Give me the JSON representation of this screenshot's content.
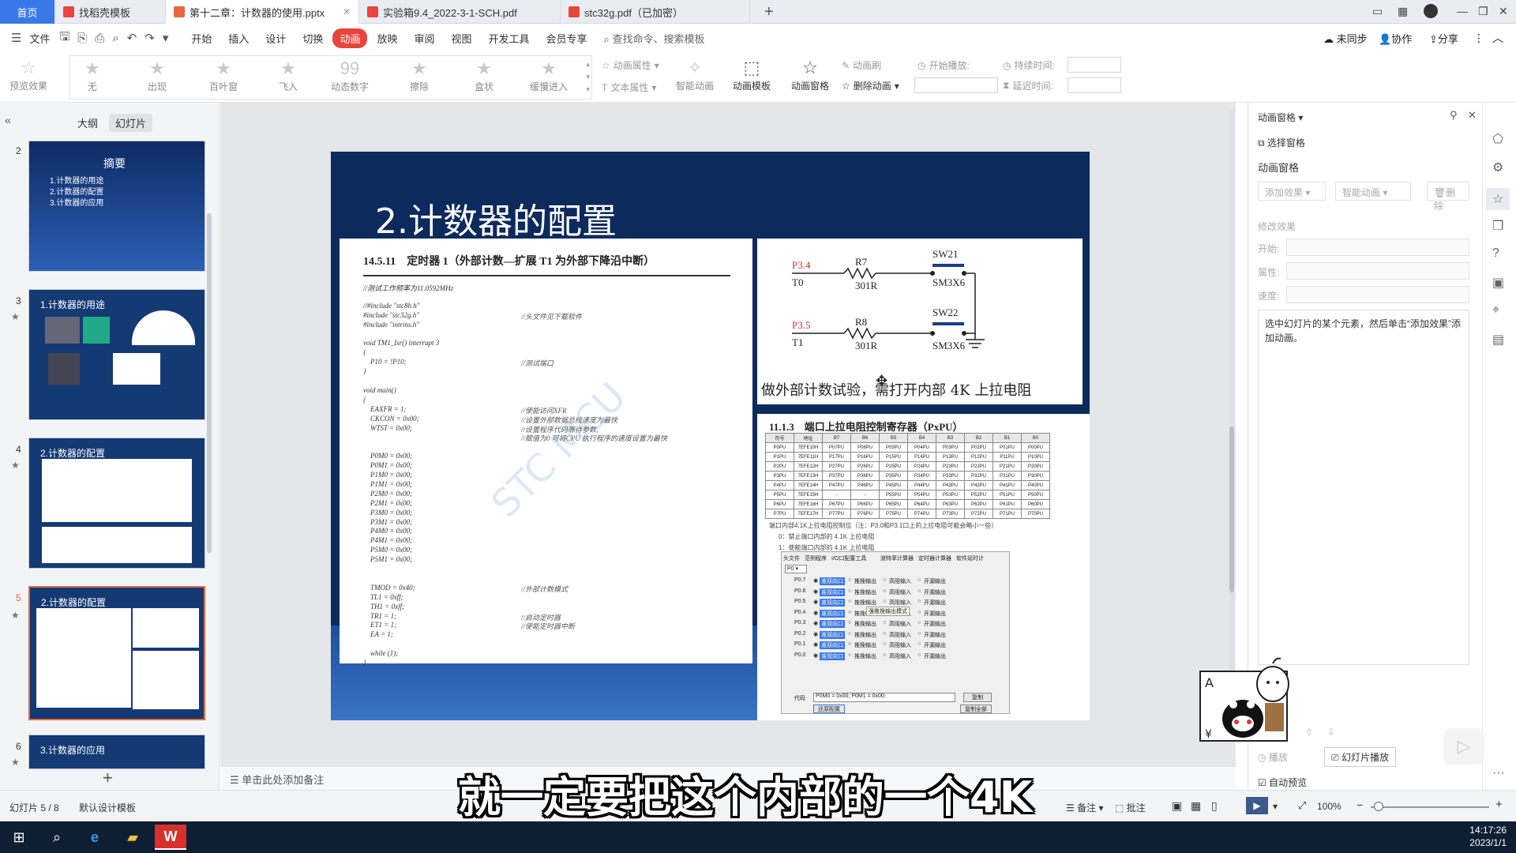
{
  "tabs": [
    {
      "label": "首页",
      "type": "home"
    },
    {
      "label": "找稻壳模板",
      "color": "#e8453c"
    },
    {
      "label": "第十二章：计数器的使用.pptx",
      "color": "#e8663c",
      "active": true
    },
    {
      "label": "实验箱9.4_2022-3-1-SCH.pdf",
      "color": "#e8453c"
    },
    {
      "label": "stc32g.pdf（已加密）",
      "color": "#e8453c"
    }
  ],
  "menu": {
    "file": "文件",
    "items": [
      "开始",
      "插入",
      "设计",
      "切换",
      "动画",
      "放映",
      "审阅",
      "视图",
      "开发工具",
      "会员专享"
    ],
    "active": "动画",
    "search": "查找命令、搜索模板",
    "sync": "未同步",
    "collab": "协作",
    "share": "分享"
  },
  "ribbon": {
    "preview": "预览效果",
    "gallery": [
      "无",
      "出现",
      "百叶窗",
      "飞入",
      "动态数字",
      "擦除",
      "盒状",
      "缓慢进入"
    ],
    "anim_props": "动画属性",
    "text_props": "文本属性",
    "smart_anim": "智能动画",
    "anim_template": "动画模板",
    "anim_pane": "动画窗格",
    "anim_brush": "动画刷",
    "delete_anim": "删除动画",
    "start_play": "开始播放:",
    "duration": "持续时间:",
    "delay": "延迟时间:"
  },
  "left_panel": {
    "tab_outline": "大纲",
    "tab_slides": "幻灯片",
    "thumbnails": [
      {
        "num": "2",
        "title": "摘要",
        "lines": [
          "1.计数器的用途",
          "2.计数器的配置",
          "3.计数器的应用"
        ]
      },
      {
        "num": "3",
        "title": "1.计数器的用途",
        "lines": []
      },
      {
        "num": "4",
        "title": "2.计数器的配置",
        "lines": []
      },
      {
        "num": "5",
        "title": "2.计数器的配置",
        "lines": [],
        "selected": true
      },
      {
        "num": "6",
        "title": "3.计数器的应用",
        "lines": []
      }
    ]
  },
  "slide": {
    "title": "2.计数器的配置",
    "code_heading": "14.5.11　定时器 1（外部计数—扩展 T1 为外部下降沿中断）",
    "code_lines": [
      "//测试工作频率为11.0592MHz",
      "",
      "//#include \"stc8h.h\"",
      "#include \"stc32g.h\"",
      "#include \"intrins.h\"",
      "",
      "void TM1_Isr() interrupt 3",
      "{",
      "    P10 = !P10;",
      "}",
      "",
      "void main()",
      "{",
      "    EAXFR = 1;",
      "    CKCON = 0x00;",
      "    WTST = 0x00;",
      "",
      "",
      "    P0M0 = 0x00;",
      "    P0M1 = 0x00;",
      "    P1M0 = 0x00;",
      "    P1M1 = 0x00;",
      "    P2M0 = 0x00;",
      "    P2M1 = 0x00;",
      "    P3M0 = 0x00;",
      "    P3M1 = 0x00;",
      "    P4M0 = 0x00;",
      "    P4M1 = 0x00;",
      "    P5M0 = 0x00;",
      "    P5M1 = 0x00;",
      "",
      "",
      "    TMOD = 0x40;",
      "    TL1 = 0xff;",
      "    TH1 = 0xff;",
      "    TR1 = 1;",
      "    ET1 = 1;",
      "    EA = 1;",
      "",
      "    while (1);",
      "}"
    ],
    "code_comments": [
      {
        "line": 3,
        "text": "//头文件见下载软件"
      },
      {
        "line": 8,
        "text": "//测试端口"
      },
      {
        "line": 13,
        "text": "//使能访问XFR"
      },
      {
        "line": 14,
        "text": "//设置外部数据总线速度为最快"
      },
      {
        "line": 15,
        "text": "//设置程序代码等待参数,"
      },
      {
        "line": 16,
        "text": "//赋值为0 可将CPU 执行程序的速度设置为最快"
      },
      {
        "line": 32,
        "text": "//外部计数模式"
      },
      {
        "line": 35,
        "text": "//启动定时器"
      },
      {
        "line": 36,
        "text": "//使能定时器中断"
      }
    ],
    "watermark": "STC MCU",
    "circuit": {
      "p34": "P3.4",
      "t0": "T0",
      "r7": "R7",
      "r7v": "301R",
      "sw21": "SW21",
      "sw21m": "SM3X6",
      "p35": "P3.5",
      "t1": "T1",
      "r8": "R8",
      "r8v": "301R",
      "sw22": "SW22",
      "sw22m": "SM3X6",
      "caption": "做外部计数试验，需打开内部 4K 上拉电阻"
    },
    "pxpu_heading": "11.1.3　端口上拉电阻控制寄存器（PxPU）",
    "pxpu_header": [
      "符号",
      "地址",
      "B7",
      "B6",
      "B5",
      "B4",
      "B3",
      "B2",
      "B1",
      "B0"
    ],
    "pxpu_rows": [
      [
        "P0PU",
        "7EFE10H",
        "P07PU",
        "P06PU",
        "P05PU",
        "P04PU",
        "P03PU",
        "P02PU",
        "P01PU",
        "P00PU"
      ],
      [
        "P1PU",
        "7EFE11H",
        "P17PU",
        "P16PU",
        "P15PU",
        "P14PU",
        "P13PU",
        "P12PU",
        "P11PU",
        "P10PU"
      ],
      [
        "P2PU",
        "7EFE12H",
        "P27PU",
        "P26PU",
        "P25PU",
        "P24PU",
        "P23PU",
        "P22PU",
        "P21PU",
        "P20PU"
      ],
      [
        "P3PU",
        "7EFE13H",
        "P37PU",
        "P36PU",
        "P35PU",
        "P34PU",
        "P33PU",
        "P32PU",
        "P31PU",
        "P30PU"
      ],
      [
        "P4PU",
        "7EFE14H",
        "P47PU",
        "P46PU",
        "P45PU",
        "P44PU",
        "P43PU",
        "P42PU",
        "P41PU",
        "P40PU"
      ],
      [
        "P5PU",
        "7EFE15H",
        "-",
        "-",
        "P55PU",
        "P54PU",
        "P53PU",
        "P52PU",
        "P51PU",
        "P50PU"
      ],
      [
        "P6PU",
        "7EFE16H",
        "P67PU",
        "P66PU",
        "P65PU",
        "P64PU",
        "P63PU",
        "P62PU",
        "P61PU",
        "P60PU"
      ],
      [
        "P7PU",
        "7EFE17H",
        "P77PU",
        "P76PU",
        "P75PU",
        "P74PU",
        "P73PU",
        "P72PU",
        "P71PU",
        "P70PU"
      ]
    ],
    "pxpu_notes": [
      "端口内部4.1K上拉电阻控制位（注：P3.0和P3.1口上的上拉电阻可能会略小一些）",
      "0：禁止端口内部的 4.1K 上拉电阻",
      "1：使能端口内部的 4.1K 上拉电阻"
    ],
    "tool_tabs": [
      "头文件",
      "范例程序",
      "I/O口配置工具",
      "波特率计算器",
      "定时器计算器",
      "软件延时计"
    ],
    "tool_port": "P0",
    "tool_rows": [
      "P0.7",
      "P0.6",
      "P0.5",
      "P0.4",
      "P0.3",
      "P0.2",
      "P0.1",
      "P0.0"
    ],
    "tool_opts": [
      "准双向口",
      "推挽输出",
      "高阻输入",
      "开漏输出"
    ],
    "tool_tooltip": "强推挽输出模式",
    "tool_code_label": "代码",
    "tool_code": "P0M0 = 0x00;  P0M1 = 0x00;",
    "tool_copy": "复制",
    "tool_reset": "还原配置",
    "tool_copy_all": "复制全部"
  },
  "notes_placeholder": "单击此处添加备注",
  "right_panel": {
    "title": "动画窗格",
    "select_pane": "选择窗格",
    "section": "动画窗格",
    "add_effect": "添加效果",
    "smart_anim": "智能动画",
    "delete": "删除",
    "modify": "修改效果",
    "start": "开始:",
    "prop": "属性:",
    "speed": "速度:",
    "hint": "选中幻灯片的某个元素，然后单击“添加效果”添加动画。",
    "play": "播放",
    "slideshow": "幻灯片播放",
    "autopreview": "自动预览"
  },
  "status": {
    "slide_count": "幻灯片 5 / 8",
    "template": "默认设计模板",
    "notes": "备注",
    "comments": "批注",
    "zoom": "100%"
  },
  "subtitle": "就一定要把这个内部的一个4K",
  "clock": {
    "time": "14:17:26",
    "date": "2023/1/1"
  }
}
